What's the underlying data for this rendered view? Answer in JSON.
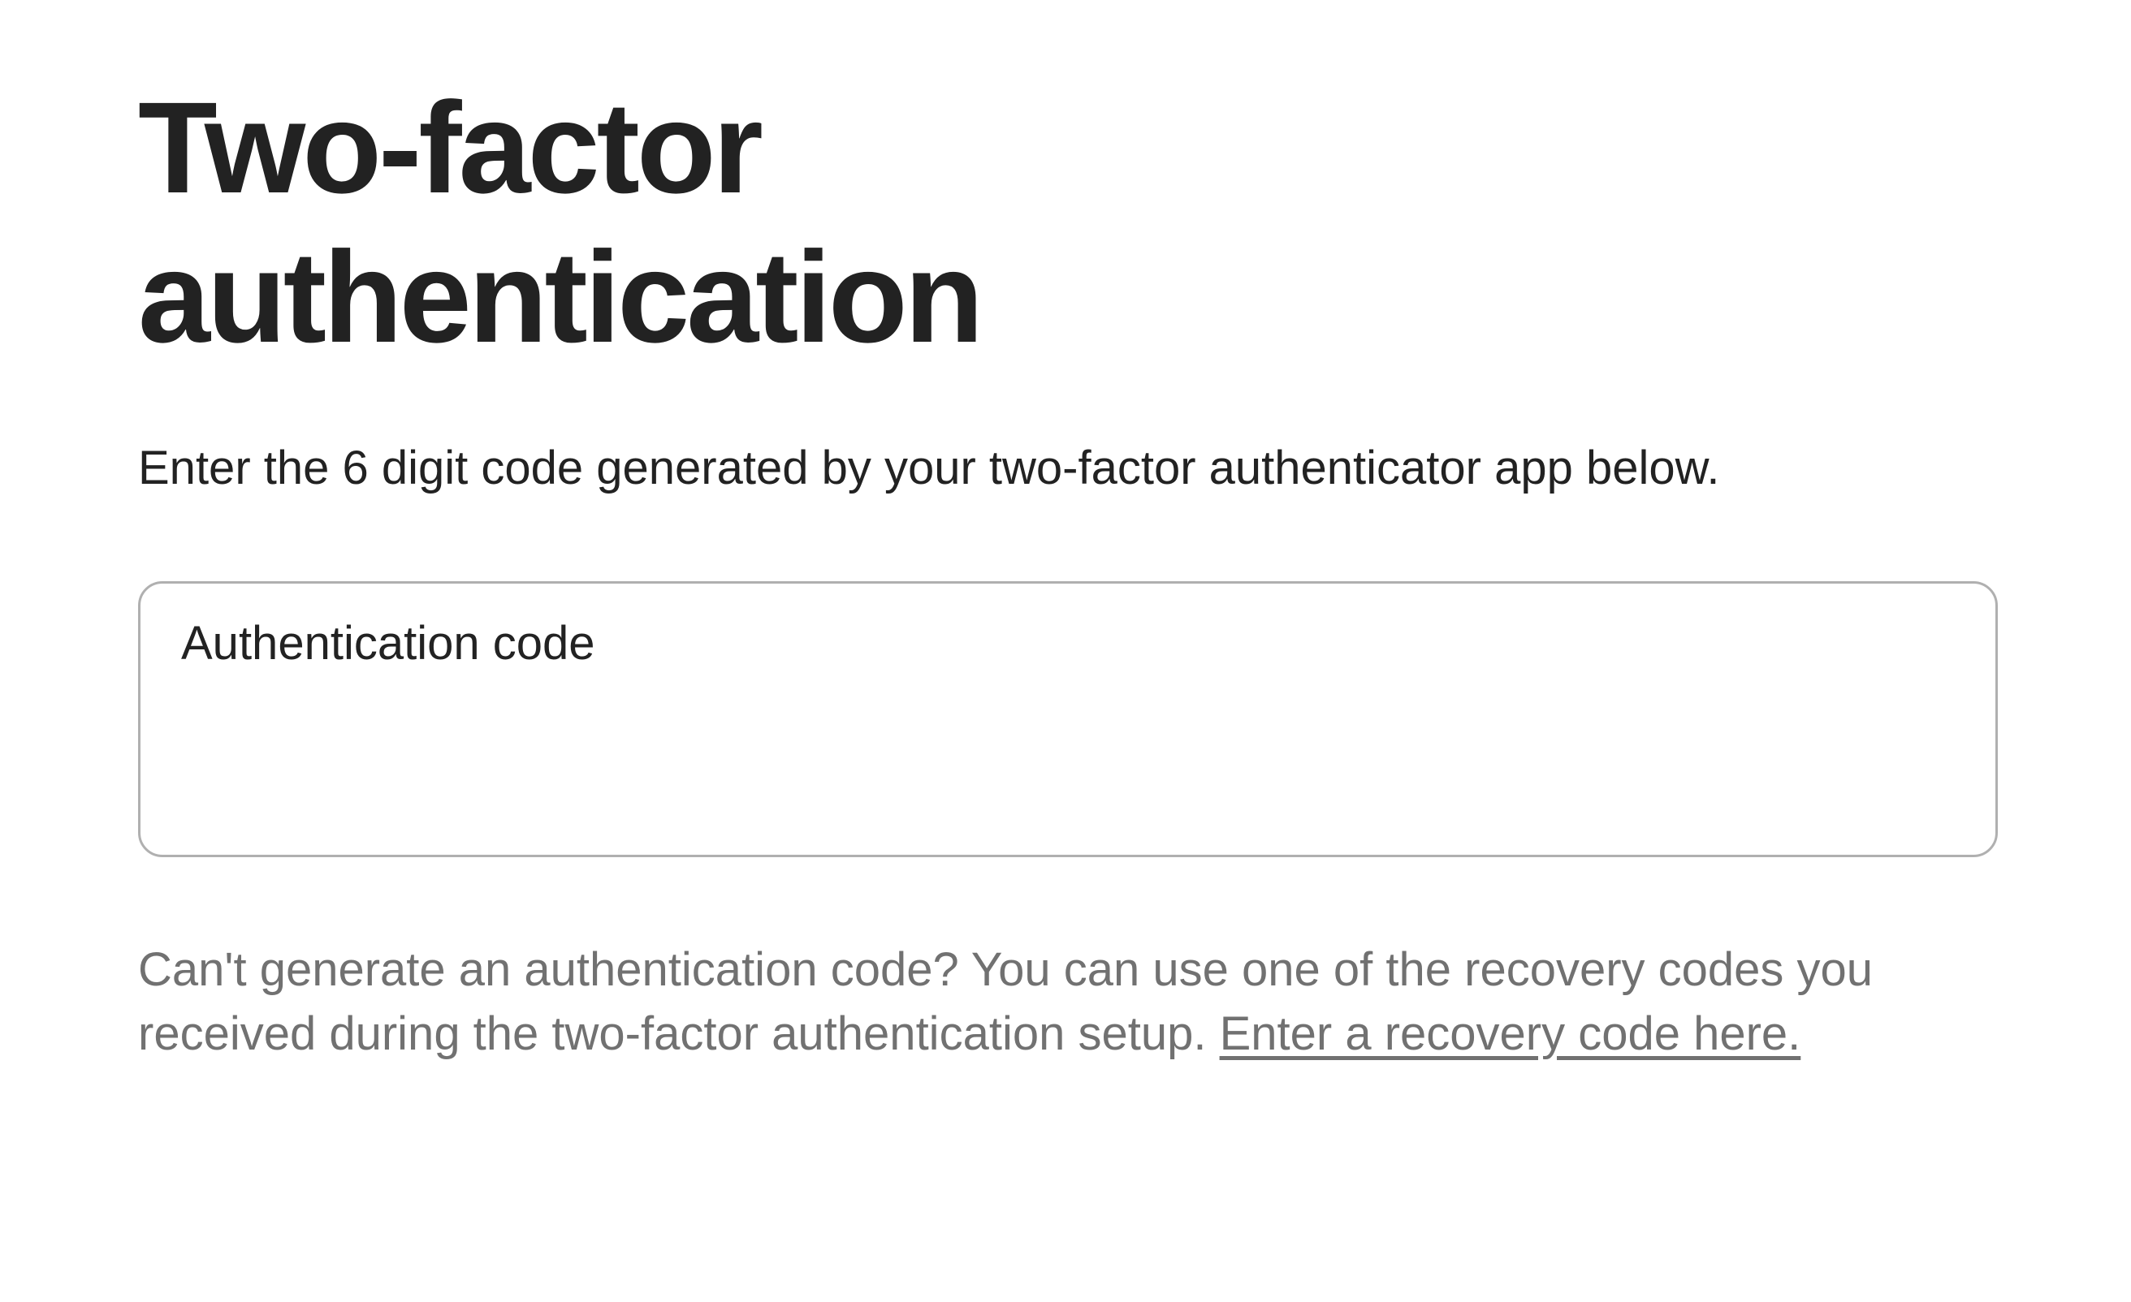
{
  "heading": "Two-factor authentication",
  "subtitle": "Enter the 6 digit code generated by your two-factor authenticator app below.",
  "input": {
    "label": "Authentication code",
    "value": ""
  },
  "helpText": {
    "prefix": "Can't generate an authentication code? You can use one of the recovery codes you received during the two-factor authentication setup. ",
    "linkText": "Enter a recovery code here."
  }
}
